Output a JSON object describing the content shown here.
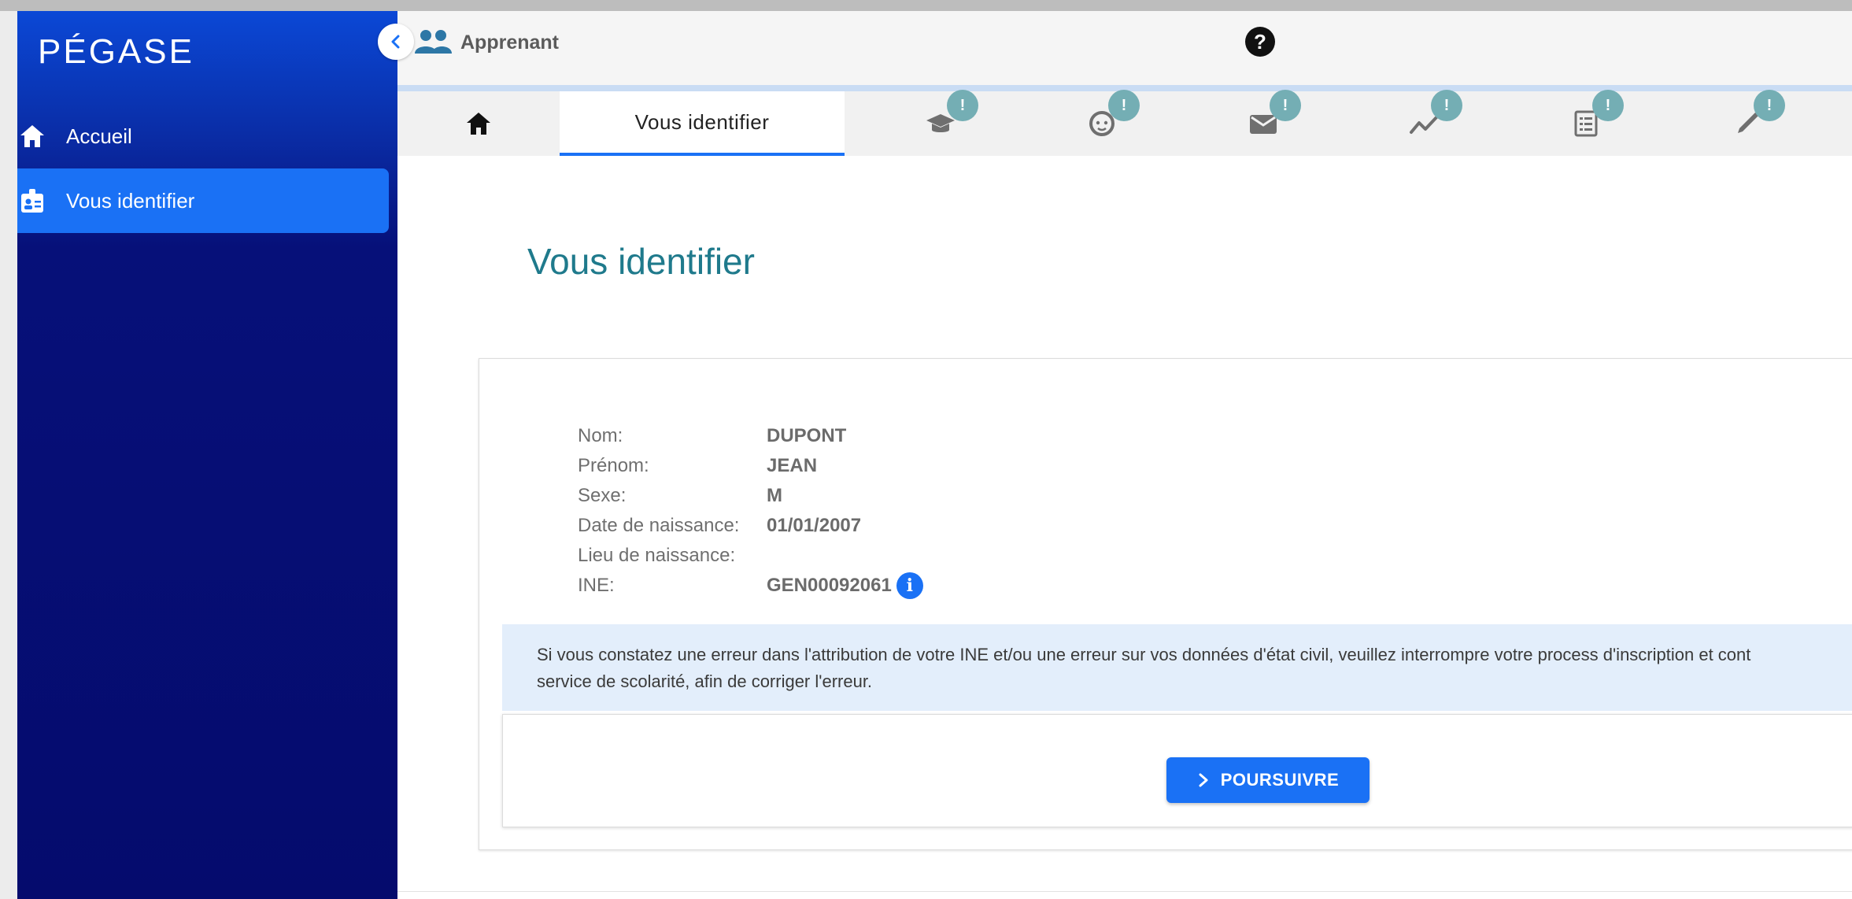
{
  "app": {
    "brand": "PÉGASE"
  },
  "sidebar": {
    "items": [
      {
        "label": "Accueil",
        "icon": "home-icon"
      },
      {
        "label": "Vous identifier",
        "icon": "id-badge-icon",
        "active": true
      }
    ]
  },
  "header": {
    "user_label": "Apprenant",
    "help_icon": "question-icon"
  },
  "tabs": [
    {
      "icon": "home-icon"
    },
    {
      "label": "Vous identifier",
      "active": true
    },
    {
      "icon": "graduation-cap-icon",
      "badge": "!"
    },
    {
      "icon": "baby-face-icon",
      "badge": "!"
    },
    {
      "icon": "envelope-icon",
      "badge": "!"
    },
    {
      "icon": "chart-line-icon",
      "badge": "!"
    },
    {
      "icon": "document-list-icon",
      "badge": "!"
    },
    {
      "icon": "pen-icon",
      "badge": "!"
    }
  ],
  "main": {
    "title": "Vous identifier",
    "identity": {
      "nom_label": "Nom:",
      "nom": "DUPONT",
      "prenom_label": "Prénom:",
      "prenom": "JEAN",
      "sexe_label": "Sexe:",
      "sexe": "M",
      "naissance_label": "Date de naissance:",
      "naissance": "01/01/2007",
      "lieu_label": "Lieu de naissance:",
      "lieu": "",
      "ine_label": "INE:",
      "ine": "GEN00092061"
    },
    "alert_line1": "Si vous constatez une erreur dans l'attribution de votre INE et/ou une erreur sur vos données d'état civil, veuillez interrompre votre process d'inscription et cont",
    "alert_line2": "service de scolarité, afin de corriger l'erreur.",
    "continue_button": "POURSUIVRE"
  },
  "colors": {
    "sidebar": "#050b6d",
    "accent": "#1a71f5",
    "title": "#1f7a8c",
    "badge": "#74aeb4"
  }
}
